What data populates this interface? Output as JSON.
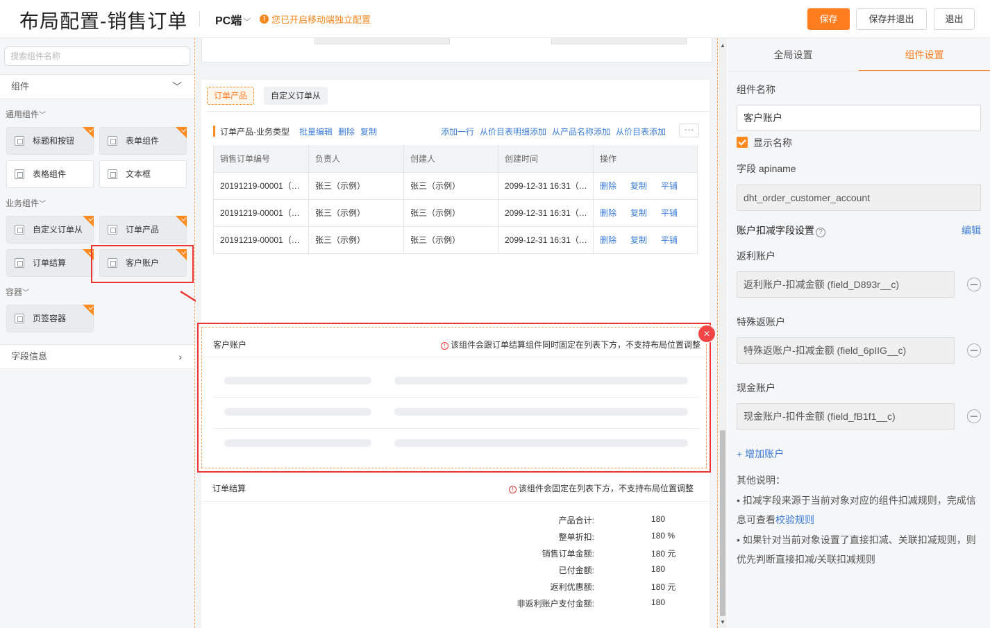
{
  "header": {
    "title": "布局配置-销售订单",
    "platform": "PC端",
    "mobile_notice": "您已开启移动端独立配置",
    "save_label": "保存",
    "save_exit_label": "保存并退出",
    "exit_label": "退出"
  },
  "left_panel": {
    "search_placeholder": "搜索组件名称",
    "components_section": "组件",
    "fields_section": "字段信息",
    "groups": {
      "general": {
        "label": "通用组件",
        "items": [
          "标题和按钮",
          "表单组件",
          "表格组件",
          "文本框"
        ]
      },
      "business": {
        "label": "业务组件",
        "items": [
          "自定义订单从",
          "订单产品",
          "订单结算",
          "客户账户"
        ]
      },
      "container": {
        "label": "容器",
        "items": [
          "页签容器"
        ]
      }
    }
  },
  "canvas": {
    "tabs": [
      "订单产品",
      "自定义订单从"
    ],
    "table_title": "订单产品-业务类型",
    "left_actions": [
      "批量编辑",
      "删除",
      "复制"
    ],
    "right_actions": [
      "添加一行",
      "从价目表明细添加",
      "从产品名称添加",
      "从价目表添加"
    ],
    "more": "···",
    "columns": [
      "销售订单编号",
      "负责人",
      "创建人",
      "创建时间",
      "操作"
    ],
    "rows": [
      {
        "no": "20191219-00001（…",
        "owner": "张三（示例）",
        "creator": "张三（示例）",
        "time": "2099-12-31 16:31（…"
      },
      {
        "no": "20191219-00001（…",
        "owner": "张三（示例）",
        "creator": "张三（示例）",
        "time": "2099-12-31 16:31（…"
      },
      {
        "no": "20191219-00001（…",
        "owner": "张三（示例）",
        "creator": "张三（示例）",
        "time": "2099-12-31 16:31（…"
      }
    ],
    "row_ops": [
      "删除",
      "复制",
      "平铺"
    ],
    "customer_account": {
      "title": "客户账户",
      "warning": "该组件会跟订单结算组件同时固定在列表下方，不支持布局位置调整",
      "close": "×"
    },
    "settlement": {
      "title": "订单结算",
      "warning": "该组件会固定在列表下方，不支持布局位置调整",
      "items": [
        {
          "label": "产品合计:",
          "value": "180"
        },
        {
          "label": "整单折扣:",
          "value": "180 %"
        },
        {
          "label": "销售订单金额:",
          "value": "180 元"
        },
        {
          "label": "已付金额:",
          "value": "180"
        },
        {
          "label": "返利优惠额:",
          "value": "180 元"
        },
        {
          "label": "非返利账户支付金额:",
          "value": "180"
        }
      ]
    }
  },
  "right_panel": {
    "tabs": [
      "全局设置",
      "组件设置"
    ],
    "active_tab": "组件设置",
    "name_label": "组件名称",
    "name_value": "客户账户",
    "show_name_label": "显示名称",
    "show_name_checked": true,
    "apiname_label": "字段 apiname",
    "apiname_value": "dht_order_customer_account",
    "deduct_label": "账户扣减字段设置",
    "edit_label": "编辑",
    "accounts": [
      {
        "label": "返利账户",
        "value": "返利账户-扣减金额 (field_D893r__c)"
      },
      {
        "label": "特殊返账户",
        "value": "特殊返账户-扣减金额 (field_6pIIG__c)"
      },
      {
        "label": "现金账户",
        "value": "现金账户-扣件金额 (field_fB1f1__c)"
      }
    ],
    "add_account": "+ 增加账户",
    "notes_title": "其他说明：",
    "note1_pre": "• 扣减字段来源于当前对象对应的组件扣减规则，完成信息可查看",
    "note1_link": "校验规则",
    "note2": "• 如果针对当前对象设置了直接扣减、关联扣减规则，则优先判断直接扣减/关联扣减规则"
  },
  "colors": {
    "accent": "#ff7d1f",
    "link": "#3b7bd8",
    "highlight": "#ee3333"
  }
}
